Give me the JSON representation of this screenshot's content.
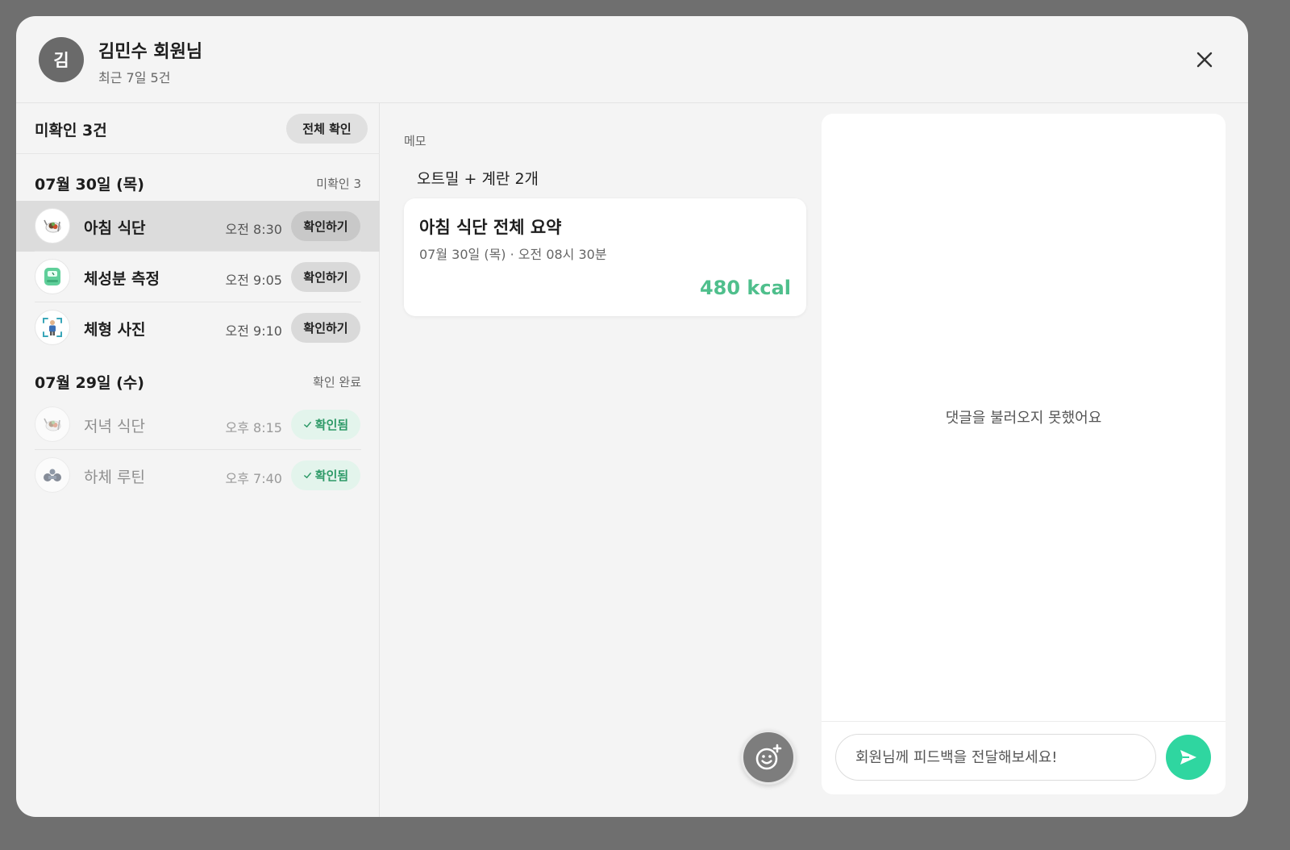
{
  "header": {
    "avatar_initial": "김",
    "member_name": "김민수 회원님",
    "subtitle": "최근 7일 5건"
  },
  "sidebar": {
    "unconfirmed_title": "미확인 3건",
    "confirm_all_label": "전체 확인",
    "groups": [
      {
        "date": "07월 30일 (목)",
        "status": "미확인 3",
        "items": [
          {
            "label": "아침 식단",
            "time": "오전 8:30",
            "action": "확인하기",
            "icon": "meal-icon"
          },
          {
            "label": "체성분 측정",
            "time": "오전 9:05",
            "action": "확인하기",
            "icon": "scale-icon"
          },
          {
            "label": "체형 사진",
            "time": "오전 9:10",
            "action": "확인하기",
            "icon": "body-photo-icon"
          }
        ]
      },
      {
        "date": "07월 29일 (수)",
        "status": "확인 완료",
        "items": [
          {
            "label": "저녁 식단",
            "time": "오후 8:15",
            "action": "확인됨",
            "icon": "meal-icon"
          },
          {
            "label": "하체 루틴",
            "time": "오후 7:40",
            "action": "확인됨",
            "icon": "dumbbell-icon"
          }
        ]
      }
    ]
  },
  "detail": {
    "memo_label": "메모",
    "memo_text": "오트밀 + 계란 2개",
    "summary_title": "아침 식단 전체 요약",
    "summary_date": "07월 30일 (목) · 오전 08시 30분",
    "summary_kcal": "480 kcal"
  },
  "comments": {
    "error_text": "댓글을 불러오지 못했어요",
    "input_placeholder": "회원님께 피드백을 전달해보세요!"
  },
  "colors": {
    "accent": "#2fd6a0",
    "kcal": "#4fbf8c",
    "confirmed_text": "#2e9a68",
    "confirmed_bg": "#e3f4ec"
  }
}
